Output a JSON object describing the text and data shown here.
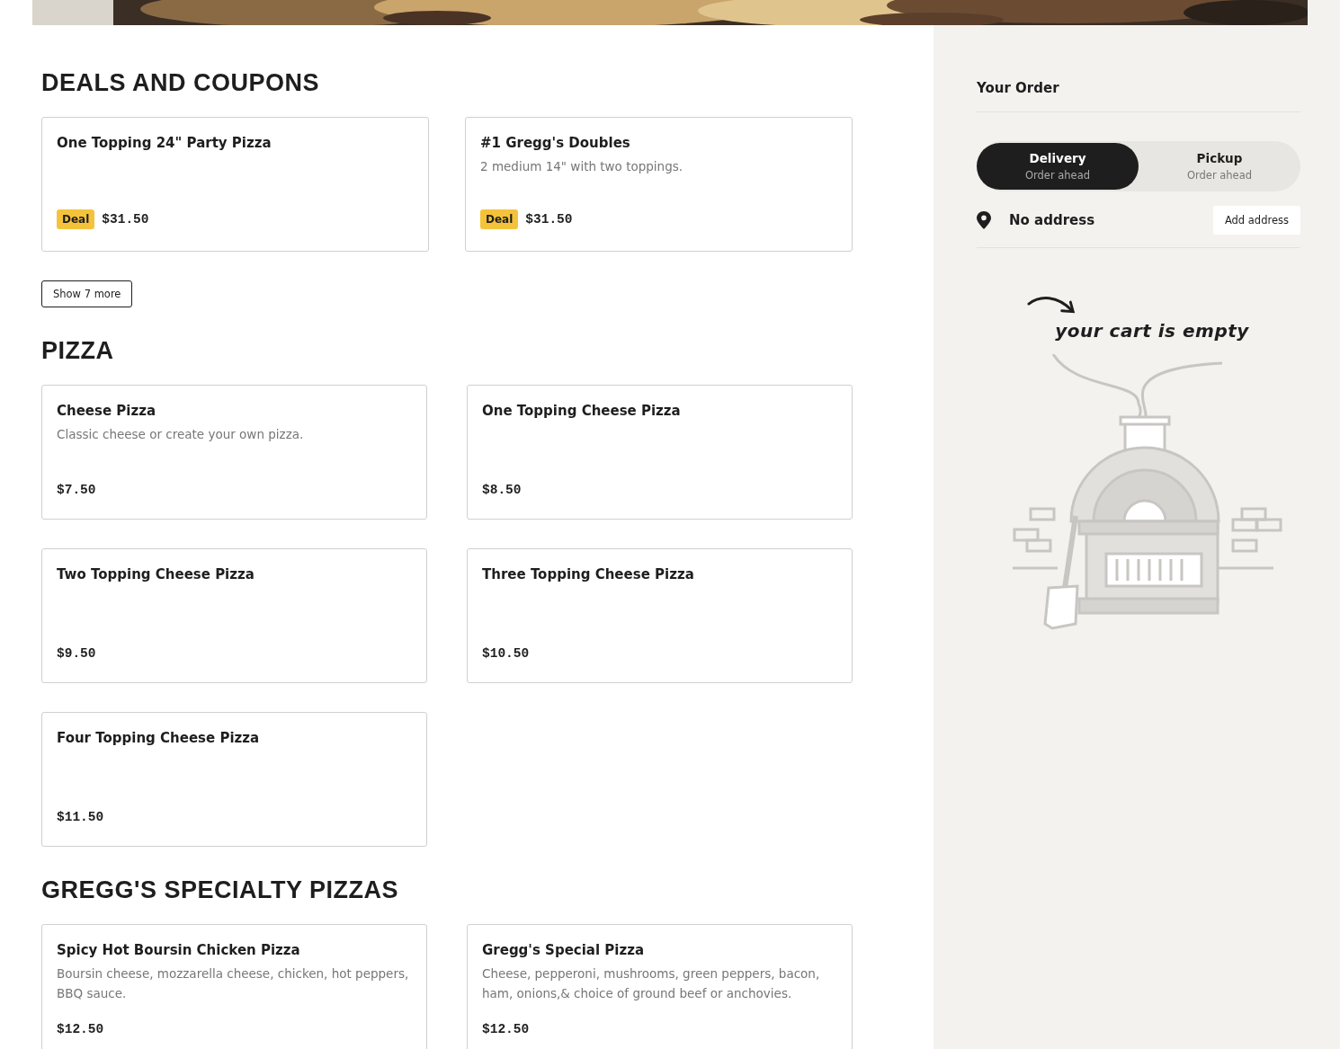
{
  "sections": [
    {
      "title": "DEALS AND COUPONS",
      "more_button": "Show 7 more",
      "items": [
        {
          "name": "One Topping 24\" Party Pizza",
          "badge": "Deal",
          "price": "$31.50"
        },
        {
          "name": "#1 Gregg's Doubles",
          "description": "2 medium 14\" with two toppings.",
          "badge": "Deal",
          "price": "$31.50"
        }
      ]
    },
    {
      "title": "PIZZA",
      "items": [
        {
          "name": "Cheese Pizza",
          "description": "Classic cheese or create your own pizza.",
          "price": "$7.50"
        },
        {
          "name": "One Topping Cheese Pizza",
          "price": "$8.50"
        },
        {
          "name": "Two Topping Cheese Pizza",
          "price": "$9.50"
        },
        {
          "name": "Three Topping Cheese Pizza",
          "price": "$10.50"
        },
        {
          "name": "Four Topping Cheese Pizza",
          "price": "$11.50"
        }
      ]
    },
    {
      "title": "GREGG'S SPECIALTY PIZZAS",
      "items": [
        {
          "name": "Spicy Hot Boursin Chicken Pizza",
          "description": "Boursin cheese, mozzarella cheese, chicken, hot peppers, BBQ sauce.",
          "price": "$12.50"
        },
        {
          "name": "Gregg's Special Pizza",
          "description": "Cheese, pepperoni, mushrooms, green peppers, bacon, ham, onions,& choice of ground beef or anchovies.",
          "price": "$12.50"
        }
      ]
    }
  ],
  "order": {
    "title": "Your Order",
    "modes": [
      {
        "label": "Delivery",
        "sublabel": "Order ahead",
        "selected": true
      },
      {
        "label": "Pickup",
        "sublabel": "Order ahead",
        "selected": false
      }
    ],
    "address": "No address",
    "address_button": "Add address",
    "empty_message": "your cart is empty"
  }
}
